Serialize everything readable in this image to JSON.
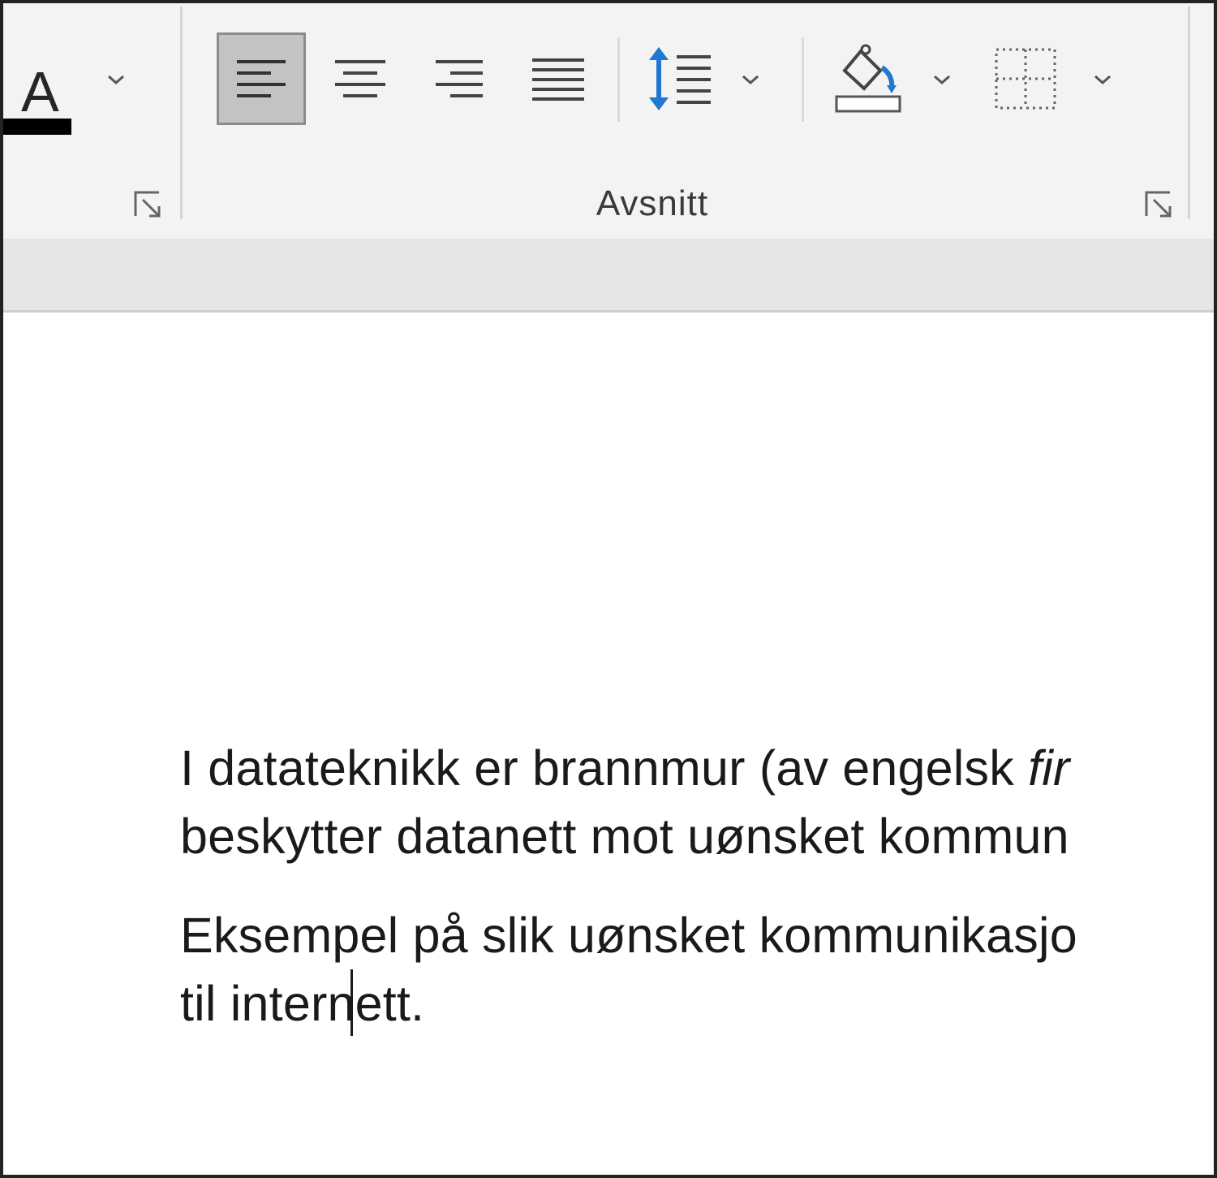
{
  "ribbon": {
    "font_color": {
      "letter": "A",
      "bar_color": "#000000"
    },
    "paragraph_group": {
      "label": "Avsnitt",
      "buttons": [
        "align-left",
        "align-center",
        "align-right",
        "justify",
        "line-spacing",
        "shading",
        "borders"
      ],
      "active": "align-left"
    },
    "accent_color": "#1f78d1"
  },
  "document": {
    "paragraph1": {
      "line1_pre": "I datateknikk er brannmur (av engelsk ",
      "line1_italic": "fir",
      "line2": "beskytter datanett mot uønsket kommun"
    },
    "paragraph2": {
      "line1": "Eksempel på slik uønsket kommunikasjo",
      "line2": "til internett."
    }
  }
}
